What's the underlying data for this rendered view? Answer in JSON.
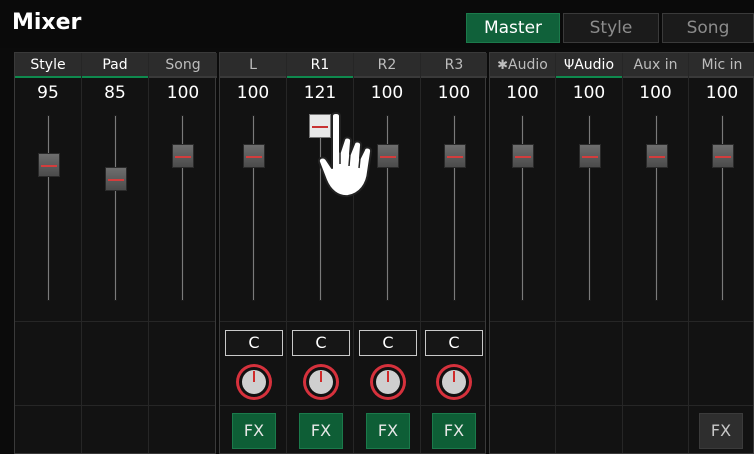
{
  "app": {
    "title": "Mixer"
  },
  "tabs": [
    {
      "label": "Master",
      "active": true
    },
    {
      "label": "Style",
      "active": false
    },
    {
      "label": "Song",
      "active": false
    }
  ],
  "groups": [
    {
      "name": "group-left",
      "channels": [
        {
          "label": "Style",
          "value": "95",
          "selected": true
        },
        {
          "label": "Pad",
          "value": "85",
          "selected": true
        },
        {
          "label": "Song",
          "value": "100",
          "selected": false
        }
      ]
    },
    {
      "name": "group-middle",
      "channels": [
        {
          "label": "L",
          "value": "100",
          "selected": false,
          "pan": "C",
          "fx": "FX"
        },
        {
          "label": "R1",
          "value": "121",
          "selected": true,
          "pan": "C",
          "fx": "FX"
        },
        {
          "label": "R2",
          "value": "100",
          "selected": false,
          "pan": "C",
          "fx": "FX"
        },
        {
          "label": "R3",
          "value": "100",
          "selected": false,
          "pan": "C",
          "fx": "FX"
        }
      ]
    },
    {
      "name": "group-right",
      "channels": [
        {
          "label": "Audio",
          "icon": "bluetooth-icon",
          "value": "100",
          "selected": false
        },
        {
          "label": "Audio",
          "icon": "usb-icon",
          "value": "100",
          "selected": true
        },
        {
          "label": "Aux in",
          "value": "100",
          "selected": false
        },
        {
          "label": "Mic in",
          "value": "100",
          "selected": false,
          "fx": "FX"
        }
      ]
    }
  ],
  "colors": {
    "accent_green": "#10613a",
    "fader_marker_red": "#d33d3d",
    "pan_dial_red": "#d6313c"
  }
}
